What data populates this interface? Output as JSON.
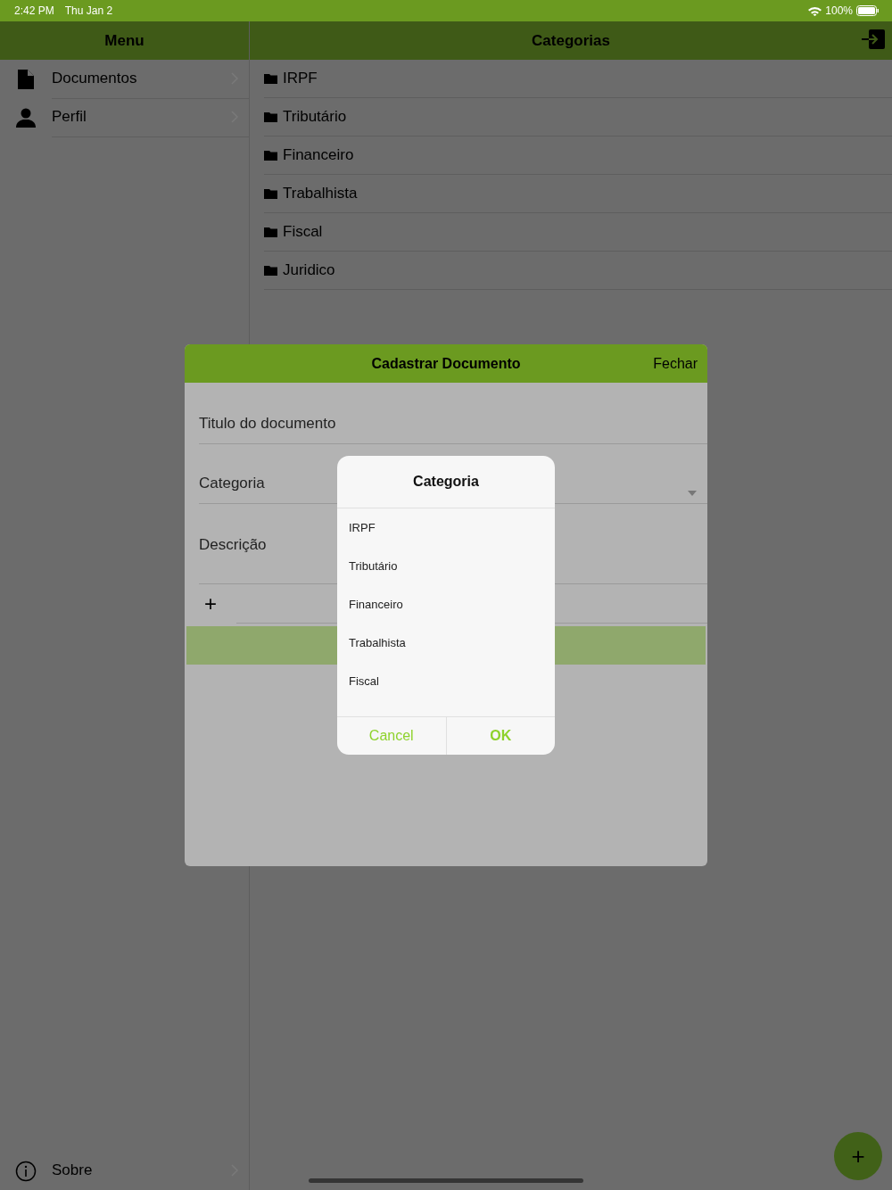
{
  "status_bar": {
    "time": "2:42 PM",
    "date": "Thu Jan 2",
    "battery": "100%"
  },
  "sidebar": {
    "title": "Menu",
    "items": [
      {
        "label": "Documentos",
        "kind": "document"
      },
      {
        "label": "Perfil",
        "kind": "person"
      }
    ],
    "footer": {
      "label": "Sobre",
      "kind": "info"
    }
  },
  "main": {
    "title": "Categorias",
    "categories": [
      "IRPF",
      "Tributário",
      "Financeiro",
      "Trabalhista",
      "Fiscal",
      "Juridico"
    ]
  },
  "modal": {
    "title": "Cadastrar Documento",
    "close": "Fechar",
    "fields": [
      {
        "placeholder": "Titulo do documento",
        "kind": "text"
      },
      {
        "placeholder": "Categoria",
        "kind": "select"
      },
      {
        "placeholder": "Descrição",
        "kind": "textarea"
      }
    ],
    "add_symbol": "+"
  },
  "picker": {
    "title": "Categoria",
    "options": [
      "IRPF",
      "Tributário",
      "Financeiro",
      "Trabalhista",
      "Fiscal"
    ],
    "buttons": [
      {
        "label": "Cancel",
        "kind": "cancel"
      },
      {
        "label": "OK",
        "kind": "confirm"
      }
    ]
  },
  "fab": {
    "symbol": "+"
  }
}
